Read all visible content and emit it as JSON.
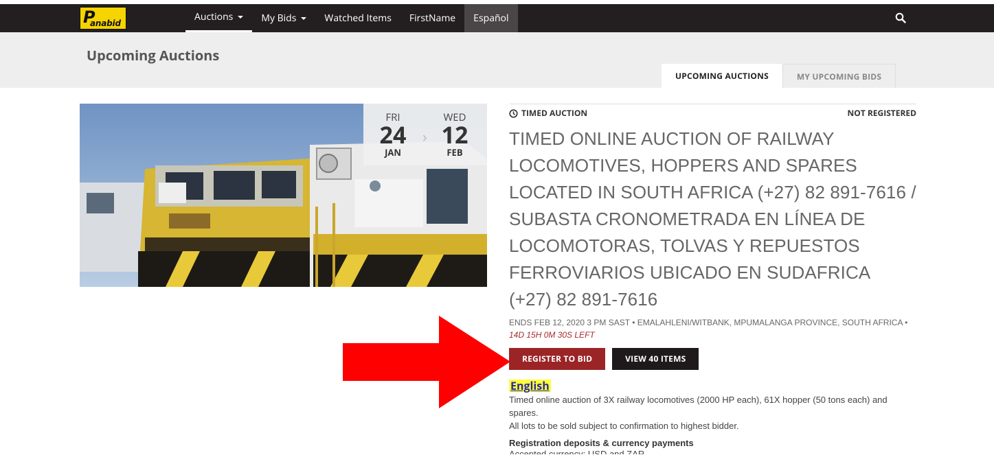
{
  "nav": {
    "logo_text": "anabid",
    "items": [
      {
        "label": "Auctions",
        "dropdown": true,
        "active": true
      },
      {
        "label": "My Bids",
        "dropdown": true,
        "active": false
      },
      {
        "label": "Watched Items",
        "dropdown": false,
        "active": false
      },
      {
        "label": "FirstName",
        "dropdown": false,
        "active": false
      }
    ],
    "language": "Español",
    "search_icon": "search-icon"
  },
  "header": {
    "title": "Upcoming Auctions",
    "tabs": [
      {
        "label": "UPCOMING AUCTIONS",
        "active": true
      },
      {
        "label": "MY UPCOMING BIDS",
        "active": false
      }
    ]
  },
  "auction": {
    "start": {
      "dow": "FRI",
      "day": "24",
      "month": "JAN"
    },
    "end": {
      "dow": "WED",
      "day": "12",
      "month": "FEB"
    },
    "type": "TIMED AUCTION",
    "status": "NOT REGISTERED",
    "title": "TIMED ONLINE AUCTION OF RAILWAY LOCOMOTIVES, HOPPERS AND SPARES LOCATED IN SOUTH AFRICA (+27) 82 891-7616 / SUBASTA CRONOMETRADA EN LÍNEA DE LOCOMOTORAS, TOLVAS Y REPUESTOS FERROVIARIOS UBICADO EN SUDAFRICA (+27) 82 891-7616",
    "ends_text": "ENDS FEB 12, 2020 3 PM SAST • EMALAHLENI/WITBANK, MPUMALANGA PROVINCE, SOUTH AFRICA •",
    "time_left": "14D 15H 0M 30S LEFT",
    "register_label": "REGISTER TO BID",
    "view_label": "VIEW 40 ITEMS",
    "language_heading": "English",
    "description_1": "Timed online auction of 3X railway locomotives (2000 HP each), 61X hopper (50 tons each) and spares.",
    "description_2": "All lots to be sold subject to confirmation to highest bidder.",
    "deposits_heading": "Registration deposits & currency payments",
    "cut_line": "Accepted currency: USD and ZAR"
  },
  "colors": {
    "nav_bg": "#231f20",
    "register_btn": "#9b2426",
    "view_btn": "#1e1a1b",
    "arrow": "#ff0000",
    "highlight": "#ffff3a"
  }
}
